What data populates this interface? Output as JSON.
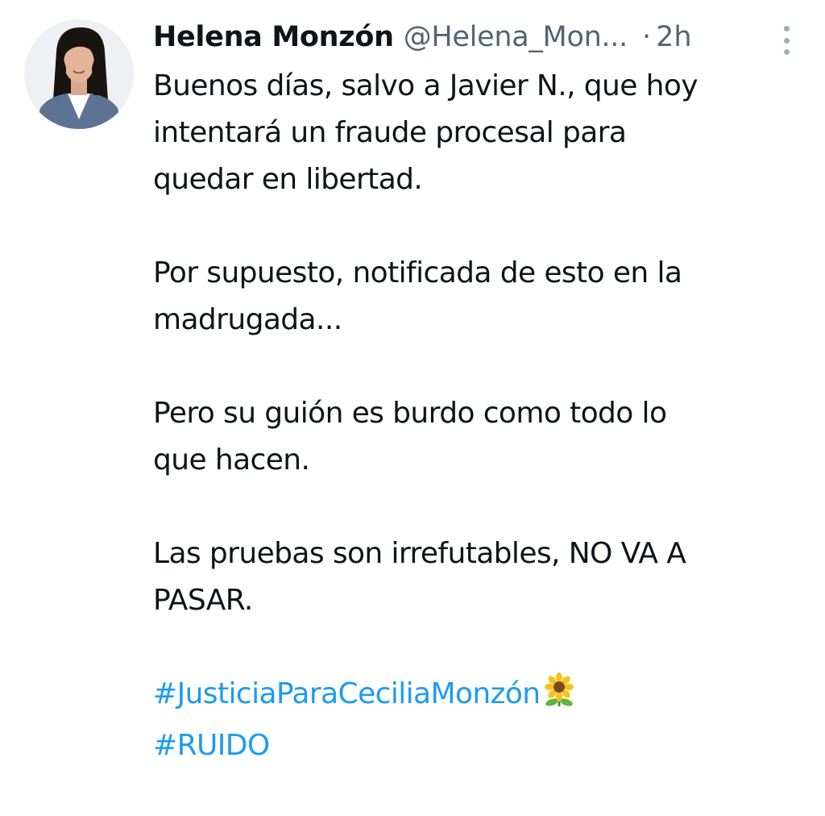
{
  "tweet": {
    "author_name": "Helena Monzón",
    "author_handle": "@Helena_Mon...",
    "separator": "·",
    "time": "2h",
    "paragraphs": [
      [
        "Buenos días, salvo a Javier N., que hoy",
        "intentará un fraude procesal para",
        "quedar en libertad."
      ],
      [
        "Por supuesto, notificada de esto en la",
        "madrugada..."
      ],
      [
        "Pero su guión es burdo como todo lo",
        "que hacen."
      ],
      [
        "Las pruebas son irrefutables, NO VA A",
        "PASAR."
      ]
    ],
    "hashtags": [
      "#JusticiaParaCeciliaMonzón",
      "#RUIDO"
    ],
    "hashtag_emoji": "sunflower-icon"
  },
  "colors": {
    "text": "#0f1419",
    "secondary": "#536471",
    "link": "#1d9bf0"
  }
}
